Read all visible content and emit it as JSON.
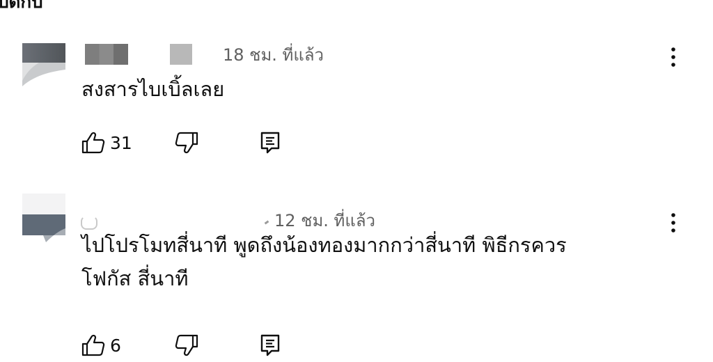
{
  "section": {
    "header_fragment": "ปดกบ"
  },
  "comments": [
    {
      "time": "18 ชม. ที่แล้ว",
      "text_lines": [
        "สงสารไบเบิ้ลเลย"
      ],
      "likes": "31"
    },
    {
      "time": "12 ชม. ที่แล้ว",
      "text_lines": [
        "ไปโปรโมทสี่นาที พูดถึงน้องทองมากกว่าสี่นาที พิธีกรควร",
        "โฟกัส สี่นาที"
      ],
      "likes": "6"
    }
  ],
  "icons": {
    "like": "thumb-up-icon",
    "dislike": "thumb-down-icon",
    "reply": "reply-icon",
    "more": "more-vert-icon"
  },
  "colors": {
    "text": "#0f0f0f",
    "secondary_text": "#606060",
    "redacted_block": "#7d7d7d",
    "background": "#ffffff"
  }
}
